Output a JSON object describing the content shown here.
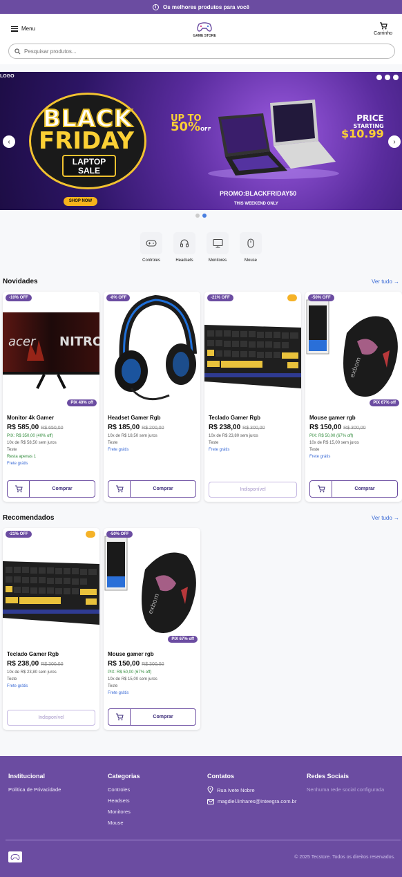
{
  "topbar": {
    "text": "Os melhores produtos para você",
    "icon": "info-icon"
  },
  "header": {
    "menu_label": "Menu",
    "logo_text": "GAME STORE",
    "cart_label": "Carrinho"
  },
  "search": {
    "placeholder": "Pesquisar produtos..."
  },
  "banner": {
    "logo_text": "LOGO",
    "title_line1": "BLACK",
    "title_line2": "FRIDAY",
    "subtitle_line1": "LAPTOP",
    "subtitle_line2": "SALE",
    "shop_button": "SHOP NOW",
    "upto_line1": "UP TO",
    "upto_value": "50%",
    "upto_off": "OFF",
    "price_line1": "PRICE",
    "price_line2": "STARTING",
    "price_value": "$10.99",
    "promo_code": "PROMO:BLACKFRIDAY50",
    "promo_note": "THIS WEEKEND ONLY",
    "slides_total": 2,
    "active_slide": 2
  },
  "categories": [
    {
      "label": "Controles",
      "icon": "gamepad-icon"
    },
    {
      "label": "Headsets",
      "icon": "headset-icon"
    },
    {
      "label": "Monitores",
      "icon": "monitor-icon"
    },
    {
      "label": "Mouse",
      "icon": "mouse-icon"
    }
  ],
  "sections": {
    "novidades": {
      "title": "Novidades",
      "see_all": "Ver tudo →"
    },
    "recomendados": {
      "title": "Recomendados",
      "see_all": "Ver tudo →"
    }
  },
  "novidades": [
    {
      "discount": "-10% OFF",
      "pix_badge": "PIX 40% off",
      "name": "Monitor 4k Gamer",
      "price": "R$ 585,00",
      "old_price": "R$ 650,00",
      "pix_line": "PIX: R$ 350,00 (40% off)",
      "installments": "10x de R$ 58,50 sem juros",
      "brand": "Teste",
      "stock": "Resta apenas 1",
      "shipping": "Frete grátis",
      "buy": "Comprar"
    },
    {
      "discount": "-8% OFF",
      "name": "Headset Gamer Rgb",
      "price": "R$ 185,00",
      "old_price": "R$ 200,00",
      "installments": "10x de R$ 18,50 sem juros",
      "brand": "Teste",
      "shipping": "Frete grátis",
      "buy": "Comprar"
    },
    {
      "discount": "-21% OFF",
      "name": "Teclado Gamer Rgb",
      "price": "R$ 238,00",
      "old_price": "R$ 300,00",
      "installments": "10x de R$ 23,80 sem juros",
      "brand": "Teste",
      "shipping": "Frete grátis",
      "unavailable": "Indisponível"
    },
    {
      "discount": "-50% OFF",
      "pix_badge": "PIX 67% off",
      "name": "Mouse gamer rgb",
      "price": "R$ 150,00",
      "old_price": "R$ 300,00",
      "pix_line": "PIX: R$ 50,00 (67% off)",
      "installments": "10x de R$ 15,00 sem juros",
      "brand": "Teste",
      "shipping": "Frete grátis",
      "buy": "Comprar"
    }
  ],
  "recomendados": [
    {
      "discount": "-21% OFF",
      "name": "Teclado Gamer Rgb",
      "price": "R$ 238,00",
      "old_price": "R$ 300,00",
      "installments": "10x de R$ 23,80 sem juros",
      "brand": "Teste",
      "shipping": "Frete grátis",
      "unavailable": "Indisponível"
    },
    {
      "discount": "-50% OFF",
      "pix_badge": "PIX 67% off",
      "name": "Mouse gamer rgb",
      "price": "R$ 150,00",
      "old_price": "R$ 300,00",
      "pix_line": "PIX: R$ 50,00 (67% off)",
      "installments": "10x de R$ 15,00 sem juros",
      "brand": "Teste",
      "shipping": "Frete grátis",
      "buy": "Comprar"
    }
  ],
  "footer": {
    "institucional": {
      "title": "Institucional",
      "items": [
        "Política de Privacidade"
      ]
    },
    "categorias": {
      "title": "Categorias",
      "items": [
        "Controles",
        "Headsets",
        "Monitores",
        "Mouse"
      ]
    },
    "contatos": {
      "title": "Contatos",
      "address": "Rua Ivete Nobre",
      "email": "magdiel.linhares@inteegra.com.br"
    },
    "redes": {
      "title": "Redes Sociais",
      "empty": "Nenhuma rede social configurada"
    },
    "copyright": "© 2025 Tecstore. Todos os direitos reservados."
  },
  "colors": {
    "brand": "#6b4ca1",
    "link": "#3b6bd6",
    "success": "#2f8a3a"
  }
}
